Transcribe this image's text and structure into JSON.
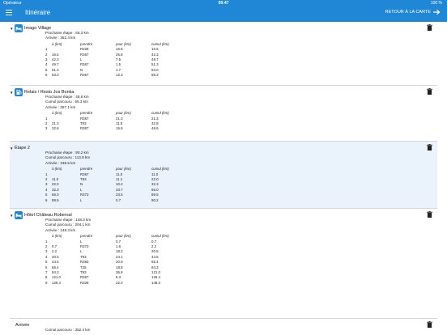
{
  "statusbar": {
    "carrier": "Opérateur",
    "time": "09:47",
    "battery": "100 %"
  },
  "navbar": {
    "title": "Itinéraire",
    "back_label": "RETOUR À LA CARTE"
  },
  "table_headers": {
    "from": "à (km)",
    "take": "prendre",
    "for": "pour (km)",
    "cumul": "cumul (km)"
  },
  "sections": [
    {
      "title": "Imago Village",
      "icon": "bed-icon",
      "info": [
        "Prochaine étape : 65.3 km",
        "Arrivée : 352.4 km"
      ],
      "rows": [
        [
          "1",
          "",
          "R328",
          "16.5",
          "16.5"
        ],
        [
          "2",
          "16.5",
          "R367",
          "25.8",
          "42.3"
        ],
        [
          "3",
          "42.3",
          "L",
          "7.5",
          "49.7"
        ],
        [
          "4",
          "49.7",
          "R367",
          "1.5",
          "51.3"
        ],
        [
          "5",
          "51.3",
          "N",
          "1.7",
          "53.0"
        ],
        [
          "6",
          "53.0",
          "R367",
          "12.3",
          "65.3"
        ]
      ]
    },
    {
      "title": "Relais / Resto Jos Bonka",
      "icon": "fuel-icon",
      "info": [
        "Prochaine étape : 48.6 km",
        "Cumul parcouru : 65.3 km",
        "Arrivée : 287.1 km"
      ],
      "rows": [
        [
          "1",
          "",
          "R367",
          "21.3",
          "21.3"
        ],
        [
          "2",
          "21.3",
          "T93",
          "11.5",
          "32.8"
        ],
        [
          "3",
          "32.8",
          "R367",
          "15.8",
          "48.6"
        ]
      ]
    },
    {
      "title": "Étape 2",
      "icon": "",
      "info": [
        "Prochaine étape : 90.2 km",
        "Cumul parcouru : 113.9 km",
        "Arrivée : 238.5 km"
      ],
      "rows": [
        [
          "1",
          "",
          "R367",
          "11.0",
          "11.0"
        ],
        [
          "2",
          "11.0",
          "T93",
          "11.1",
          "22.0"
        ],
        [
          "3",
          "22.0",
          "N",
          "10.2",
          "32.3"
        ],
        [
          "4",
          "32.3",
          "L",
          "33.7",
          "66.0"
        ],
        [
          "5",
          "66.0",
          "R373",
          "23.5",
          "89.5"
        ],
        [
          "6",
          "89.5",
          "L",
          "0.7",
          "90.2"
        ]
      ]
    },
    {
      "title": "Hôtel Château Roberval",
      "icon": "bed-icon",
      "info": [
        "Prochaine étape : 148.3 km",
        "Cumul parcouru : 204.1 km",
        "Arrivée : 148.3 km"
      ],
      "rows": [
        [
          "1",
          "",
          "L",
          "0.7",
          "0.7"
        ],
        [
          "2",
          "0.7",
          "R373",
          "1.6",
          "2.2"
        ],
        [
          "3",
          "2.2",
          "L",
          "18.2",
          "20.5"
        ],
        [
          "4",
          "20.5",
          "T93",
          "24.1",
          "44.6"
        ],
        [
          "5",
          "44.6",
          "R383",
          "20.9",
          "65.4"
        ],
        [
          "6",
          "65.4",
          "T25",
          "18.8",
          "84.3"
        ],
        [
          "7",
          "84.3",
          "T93",
          "36.8",
          "121.0"
        ],
        [
          "8",
          "121.0",
          "R367",
          "5.3",
          "126.4"
        ],
        [
          "9",
          "126.4",
          "R328",
          "22.0",
          "148.3"
        ]
      ]
    },
    {
      "title": "Arrivée",
      "icon": "",
      "info": [
        "Cumul parcouru : 352.4 km"
      ],
      "rows": []
    }
  ],
  "colors": {
    "accent": "#1f87d6",
    "highlight": "#eaf2fb"
  }
}
